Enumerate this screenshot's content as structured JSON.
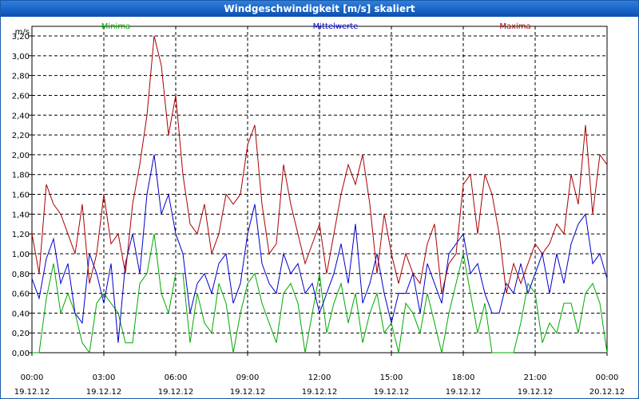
{
  "window": {
    "title": "Windgeschwindigkeit [m/s] skaliert"
  },
  "chart_data": {
    "type": "line",
    "title": "Windgeschwindigkeit [m/s] skaliert",
    "ylabel": "m/s",
    "ylim": [
      0,
      3.2
    ],
    "yticks": [
      "0,00",
      "0,20",
      "0,40",
      "0,60",
      "0,80",
      "1,00",
      "1,20",
      "1,40",
      "1,60",
      "1,80",
      "2,00",
      "2,20",
      "2,40",
      "2,60",
      "2,80",
      "3,00",
      "3,20"
    ],
    "xlim": [
      0,
      24
    ],
    "xticks": [
      {
        "time": "00:00",
        "date": "19.12.12"
      },
      {
        "time": "03:00",
        "date": "19.12.12"
      },
      {
        "time": "06:00",
        "date": "19.12.12"
      },
      {
        "time": "09:00",
        "date": "19.12.12"
      },
      {
        "time": "12:00",
        "date": "19.12.12"
      },
      {
        "time": "15:00",
        "date": "19.12.12"
      },
      {
        "time": "18:00",
        "date": "19.12.12"
      },
      {
        "time": "21:00",
        "date": "19.12.12"
      },
      {
        "time": "00:00",
        "date": "20.12.12"
      }
    ],
    "grid": true,
    "legend_position": "top",
    "series": [
      {
        "name": "Minima",
        "color": "#00aa00",
        "x": [
          0,
          0.3,
          0.6,
          0.9,
          1.2,
          1.5,
          1.8,
          2.1,
          2.4,
          2.7,
          3.0,
          3.3,
          3.6,
          3.9,
          4.2,
          4.5,
          4.8,
          5.1,
          5.4,
          5.7,
          6.0,
          6.3,
          6.6,
          6.9,
          7.2,
          7.5,
          7.8,
          8.1,
          8.4,
          8.7,
          9.0,
          9.3,
          9.6,
          9.9,
          10.2,
          10.5,
          10.8,
          11.1,
          11.4,
          11.7,
          12.0,
          12.3,
          12.6,
          12.9,
          13.2,
          13.5,
          13.8,
          14.1,
          14.4,
          14.7,
          15.0,
          15.3,
          15.6,
          15.9,
          16.2,
          16.5,
          16.8,
          17.1,
          17.4,
          17.7,
          18.0,
          18.3,
          18.6,
          18.9,
          19.2,
          19.5,
          19.8,
          20.1,
          20.4,
          20.7,
          21.0,
          21.3,
          21.6,
          21.9,
          22.2,
          22.5,
          22.8,
          23.1,
          23.4,
          23.7,
          24.0
        ],
        "values": [
          0.0,
          0.0,
          0.55,
          0.9,
          0.4,
          0.6,
          0.4,
          0.1,
          0.0,
          0.5,
          0.6,
          0.5,
          0.4,
          0.1,
          0.1,
          0.7,
          0.8,
          1.2,
          0.6,
          0.4,
          0.8,
          0.8,
          0.1,
          0.6,
          0.3,
          0.2,
          0.7,
          0.5,
          0.0,
          0.4,
          0.7,
          0.8,
          0.5,
          0.3,
          0.1,
          0.6,
          0.7,
          0.5,
          0.0,
          0.4,
          0.8,
          0.2,
          0.5,
          0.7,
          0.3,
          0.6,
          0.1,
          0.4,
          0.6,
          0.2,
          0.3,
          0.0,
          0.5,
          0.4,
          0.2,
          0.6,
          0.3,
          0.0,
          0.4,
          0.7,
          1.0,
          0.6,
          0.2,
          0.5,
          0.0,
          0.0,
          0.0,
          0.0,
          0.3,
          0.7,
          0.6,
          0.1,
          0.3,
          0.2,
          0.5,
          0.5,
          0.2,
          0.6,
          0.7,
          0.5,
          0.0
        ]
      },
      {
        "name": "Mittelwerte",
        "color": "#0000cc",
        "x": [
          0,
          0.3,
          0.6,
          0.9,
          1.2,
          1.5,
          1.8,
          2.1,
          2.4,
          2.7,
          3.0,
          3.3,
          3.6,
          3.9,
          4.2,
          4.5,
          4.8,
          5.1,
          5.4,
          5.7,
          6.0,
          6.3,
          6.6,
          6.9,
          7.2,
          7.5,
          7.8,
          8.1,
          8.4,
          8.7,
          9.0,
          9.3,
          9.6,
          9.9,
          10.2,
          10.5,
          10.8,
          11.1,
          11.4,
          11.7,
          12.0,
          12.3,
          12.6,
          12.9,
          13.2,
          13.5,
          13.8,
          14.1,
          14.4,
          14.7,
          15.0,
          15.3,
          15.6,
          15.9,
          16.2,
          16.5,
          16.8,
          17.1,
          17.4,
          17.7,
          18.0,
          18.3,
          18.6,
          18.9,
          19.2,
          19.5,
          19.8,
          20.1,
          20.4,
          20.7,
          21.0,
          21.3,
          21.6,
          21.9,
          22.2,
          22.5,
          22.8,
          23.1,
          23.4,
          23.7,
          24.0
        ],
        "values": [
          0.75,
          0.55,
          0.95,
          1.15,
          0.7,
          0.9,
          0.4,
          0.3,
          1.0,
          0.8,
          0.5,
          0.9,
          0.1,
          0.9,
          1.2,
          0.8,
          1.6,
          2.0,
          1.4,
          1.6,
          1.2,
          1.0,
          0.4,
          0.7,
          0.8,
          0.6,
          0.9,
          1.0,
          0.5,
          0.7,
          1.2,
          1.5,
          0.9,
          0.7,
          0.6,
          1.0,
          0.8,
          0.9,
          0.6,
          0.7,
          0.4,
          0.6,
          0.8,
          1.1,
          0.7,
          1.3,
          0.5,
          0.7,
          1.0,
          0.6,
          0.3,
          0.6,
          0.6,
          0.8,
          0.4,
          0.9,
          0.7,
          0.5,
          1.0,
          1.1,
          1.2,
          0.8,
          0.9,
          0.6,
          0.4,
          0.4,
          0.7,
          0.6,
          0.9,
          0.6,
          0.8,
          1.0,
          0.6,
          1.0,
          0.7,
          1.1,
          1.3,
          1.4,
          0.9,
          1.0,
          0.75
        ]
      },
      {
        "name": "Maxima",
        "color": "#aa0000",
        "x": [
          0,
          0.3,
          0.6,
          0.9,
          1.2,
          1.5,
          1.8,
          2.1,
          2.4,
          2.7,
          3.0,
          3.3,
          3.6,
          3.9,
          4.2,
          4.5,
          4.8,
          5.1,
          5.4,
          5.7,
          6.0,
          6.3,
          6.6,
          6.9,
          7.2,
          7.5,
          7.8,
          8.1,
          8.4,
          8.7,
          9.0,
          9.3,
          9.6,
          9.9,
          10.2,
          10.5,
          10.8,
          11.1,
          11.4,
          11.7,
          12.0,
          12.3,
          12.6,
          12.9,
          13.2,
          13.5,
          13.8,
          14.1,
          14.4,
          14.7,
          15.0,
          15.3,
          15.6,
          15.9,
          16.2,
          16.5,
          16.8,
          17.1,
          17.4,
          17.7,
          18.0,
          18.3,
          18.6,
          18.9,
          19.2,
          19.5,
          19.8,
          20.1,
          20.4,
          20.7,
          21.0,
          21.3,
          21.6,
          21.9,
          22.2,
          22.5,
          22.8,
          23.1,
          23.4,
          23.7,
          24.0
        ],
        "values": [
          1.2,
          0.8,
          1.7,
          1.5,
          1.4,
          1.2,
          1.0,
          1.5,
          0.7,
          1.0,
          1.6,
          1.1,
          1.2,
          0.8,
          1.5,
          1.9,
          2.4,
          3.2,
          2.9,
          2.2,
          2.6,
          1.8,
          1.3,
          1.2,
          1.5,
          1.0,
          1.2,
          1.6,
          1.5,
          1.6,
          2.1,
          2.3,
          1.5,
          1.0,
          1.1,
          1.9,
          1.5,
          1.2,
          0.9,
          1.1,
          1.3,
          0.8,
          1.2,
          1.6,
          1.9,
          1.7,
          2.0,
          1.5,
          0.8,
          1.4,
          1.0,
          0.7,
          1.0,
          0.8,
          0.7,
          1.1,
          1.3,
          0.6,
          0.9,
          1.0,
          1.7,
          1.8,
          1.2,
          1.8,
          1.6,
          1.2,
          0.6,
          0.9,
          0.7,
          0.9,
          1.1,
          1.0,
          1.1,
          1.3,
          1.2,
          1.8,
          1.5,
          2.3,
          1.4,
          2.0,
          1.9
        ]
      }
    ]
  }
}
